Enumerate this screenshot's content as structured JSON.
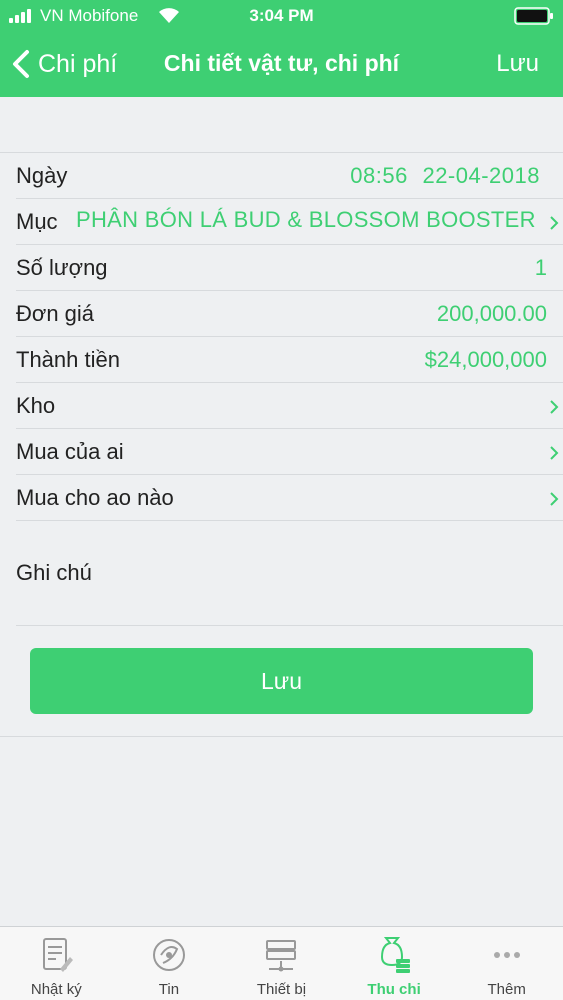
{
  "status": {
    "carrier": "VN Mobifone",
    "time": "3:04 PM"
  },
  "nav": {
    "back": "Chi phí",
    "title": "Chi tiết vật tư, chi phí",
    "save": "Lưu"
  },
  "rows": {
    "date": {
      "label": "Ngày",
      "time": "08:56",
      "date": "22-04-2018"
    },
    "category": {
      "label": "Mục",
      "value": "PHÂN BÓN LÁ BUD & BLOSSOM BOOSTER"
    },
    "quantity": {
      "label": "Số lượng",
      "value": "1"
    },
    "unit_price": {
      "label": "Đơn giá",
      "value": "200,000.00"
    },
    "total": {
      "label": "Thành tiền",
      "value": "$24,000,000"
    },
    "warehouse": {
      "label": "Kho"
    },
    "bought_from": {
      "label": "Mua của ai"
    },
    "bought_for": {
      "label": "Mua cho ao nào"
    }
  },
  "note": {
    "label": "Ghi chú"
  },
  "save_button": "Lưu",
  "tabs": [
    {
      "label": "Nhật ký",
      "icon": "journal-icon"
    },
    {
      "label": "Tin",
      "icon": "news-icon"
    },
    {
      "label": "Thiết bị",
      "icon": "device-icon"
    },
    {
      "label": "Thu chi",
      "icon": "money-icon",
      "active": true
    },
    {
      "label": "Thêm",
      "icon": "more-icon"
    }
  ],
  "colors": {
    "accent": "#3ecf73",
    "background": "#eef0f2"
  }
}
